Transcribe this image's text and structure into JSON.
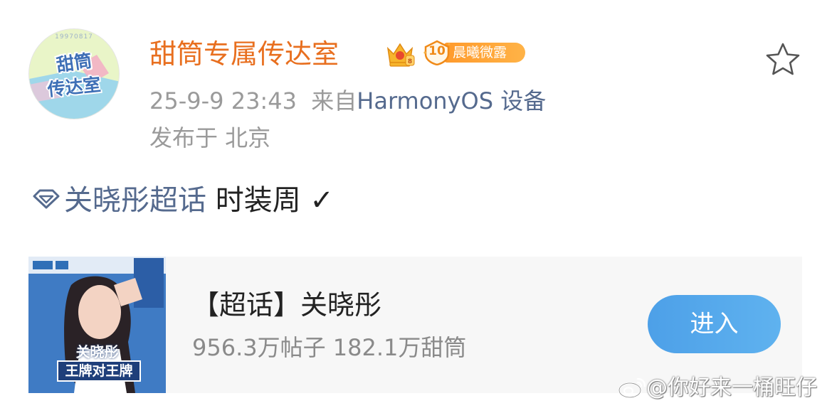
{
  "post": {
    "author": {
      "avatar_number": "19970817",
      "avatar_line1": "甜筒",
      "avatar_line2": "传达室",
      "name": "甜筒专属传达室",
      "crown_icon": "crown-vip-icon",
      "level_badge": {
        "level": "10",
        "label": "晨曦微露"
      }
    },
    "favorite_icon": "star-icon",
    "timestamp": "25-9-9 23:43",
    "source_prefix": "来自",
    "source_device": "HarmonyOS 设备",
    "location": "发布于 北京",
    "text": {
      "topic_link": "关晓彤超话",
      "body": " 时装周 ✓"
    }
  },
  "topic_card": {
    "cover": {
      "name": "关晓彤",
      "slogan": "王牌对王牌"
    },
    "title": "【超话】关晓彤",
    "stats": "956.3万帖子 182.1万甜筒",
    "enter_label": "进入"
  },
  "watermark": {
    "text": "@你好来一桶旺仔"
  },
  "colors": {
    "username": "#e86f1f",
    "link": "#556a8e",
    "meta_gray": "#9a9a9a",
    "button_blue": "#4da0e8",
    "badge_orange": "#ff9a2c",
    "card_bg": "#f7f7f7"
  }
}
